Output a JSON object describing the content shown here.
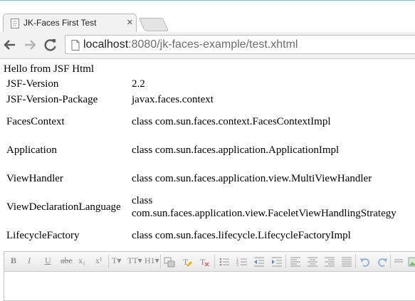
{
  "browser": {
    "tab_title": "JK-Faces First Test",
    "close_glyph": "×",
    "url_host": "localhost",
    "url_path": ":8080/jk-faces-example/test.xhtml"
  },
  "page": {
    "hello": "Hello from JSF Html",
    "properties": [
      {
        "label": "JSF-Version",
        "value": "2.2"
      },
      {
        "label": "JSF-Version-Package",
        "value": "javax.faces.context"
      },
      {
        "label": "FacesContext",
        "value": "class com.sun.faces.context.FacesContextImpl"
      },
      {
        "label": "Application",
        "value": "class com.sun.faces.application.ApplicationImpl"
      },
      {
        "label": "ViewHandler",
        "value": "class com.sun.faces.application.view.MultiViewHandler"
      },
      {
        "label": "ViewDeclarationLanguage",
        "value_line1": "class",
        "value_line2": "com.sun.faces.application.view.FaceletViewHandlingStrategy"
      },
      {
        "label": "LifecycleFactory",
        "value": "class com.sun.faces.lifecycle.LifecycleFactoryImpl"
      }
    ]
  },
  "editor": {
    "buttons": {
      "bold": "B",
      "italic": "I",
      "underline": "U",
      "strike": "abc",
      "subscript": "x₁",
      "superscript": "x¹",
      "font_family": "T▾",
      "font_size": "TT▾",
      "heading": "H1▾"
    }
  }
}
